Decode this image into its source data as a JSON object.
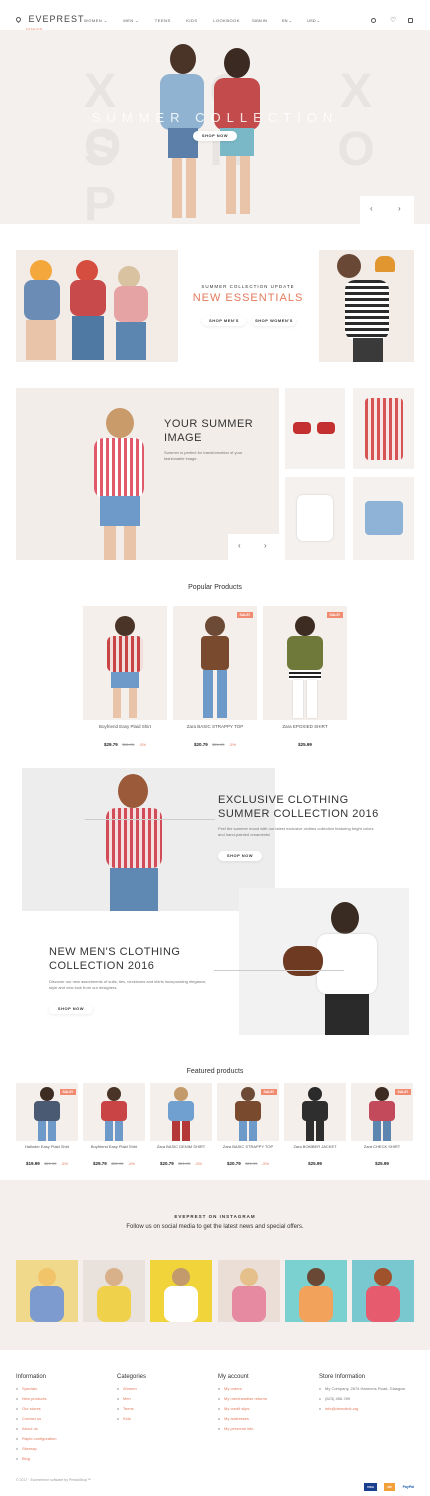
{
  "header": {
    "logo_text": "EVEPREST",
    "logo_sub": "FASHION",
    "nav": [
      {
        "label": "WOMEN ⌄"
      },
      {
        "label": "MEN ⌄"
      },
      {
        "label": "TEENS"
      },
      {
        "label": "KIDS"
      },
      {
        "label": "LOOKBOOK"
      }
    ],
    "sign_in": "SIGN IN",
    "lang": "EN ⌄",
    "currency": "USD ⌄"
  },
  "hero": {
    "bg_letters_1": "X O X O",
    "bg_letters_2": "S H O P",
    "subtitle": "SUMMER COLLECTION",
    "button": "SHOP NOW",
    "prev": "‹",
    "next": "›"
  },
  "promo": {
    "eyebrow": "SUMMER COLLECTION UPDATE",
    "title": "NEW ESSENTIALS",
    "btn_men": "SHOP MEN'S",
    "btn_women": "SHOP WOMEN'S"
  },
  "summer": {
    "title_line1": "YOUR SUMMER",
    "title_line2": "IMAGE",
    "desc": "Summer is perfect for transformation of your fashionable image.",
    "prev": "‹",
    "next": "›"
  },
  "popular": {
    "heading": "Popular Products",
    "items": [
      {
        "name": "Boyfriend Easy Plaid Shirt",
        "price": "$29.79",
        "old": "$31.95",
        "disc": "-5%",
        "sale": ""
      },
      {
        "name": "Zara BASIC STRAPPY TOP",
        "price": "$20.79",
        "old": "$21.95",
        "disc": "-5%",
        "sale": "SALE!"
      },
      {
        "name": "Zara EPOXIED SHIRT",
        "price": "$25.99",
        "old": "",
        "disc": "",
        "sale": "SALE!"
      }
    ]
  },
  "exclusive": {
    "title_line1": "EXCLUSIVE CLOTHING",
    "title_line2": "SUMMER COLLECTION 2016",
    "desc": "Feel the summer mood with our latest exclusive clothes collection featuring bright colors and hand-painted ornaments!",
    "button": "SHOP NOW"
  },
  "mens": {
    "title_line1": "NEW MEN'S CLOTHING",
    "title_line2": "COLLECTION 2016",
    "desc": "Discover our new assortments of suits, ties, neckloons and shirts incorporating elegance, style and new look from our designers.",
    "button": "SHOP NOW"
  },
  "featured": {
    "heading": "Featured products",
    "items": [
      {
        "name": "Halloder Easy Plaid Shirt",
        "price": "$19.99",
        "old": "$21.95",
        "disc": "-5%",
        "sale": "SALE!"
      },
      {
        "name": "Boyfriend Easy Plaid Shirt",
        "price": "$29.79",
        "old": "$31.95",
        "disc": "-5%",
        "sale": ""
      },
      {
        "name": "Zara BASIC DENIM SHIRT",
        "price": "$20.79",
        "old": "$21.95",
        "disc": "-5%",
        "sale": ""
      },
      {
        "name": "Zara BASIC STRAPPY TOP",
        "price": "$20.79",
        "old": "$21.95",
        "disc": "-5%",
        "sale": "SALE!"
      },
      {
        "name": "Zara BOMBER JACKET",
        "price": "$25.99",
        "old": "",
        "disc": "",
        "sale": ""
      },
      {
        "name": "Zara CHECK SHIRT",
        "price": "$25.99",
        "old": "",
        "disc": "",
        "sale": "SALE!"
      }
    ]
  },
  "instagram": {
    "eyebrow": "EVEPREST ON INSTAGRAM",
    "title": "Follow us on social media to get the latest news and special offers."
  },
  "footer": {
    "col1": {
      "heading": "Information",
      "links": [
        "Specials",
        "New products",
        "Our stores",
        "Contact us",
        "About us",
        "Rapid configuration",
        "Sitemap",
        "Blog"
      ]
    },
    "col2": {
      "heading": "Categories",
      "links": [
        "Women",
        "Men",
        "Teens",
        "Kids"
      ]
    },
    "col3": {
      "heading": "My account",
      "links": [
        "My orders",
        "My merchandise returns",
        "My credit slips",
        "My addresses",
        "My personal info"
      ]
    },
    "col4": {
      "heading": "Store Information",
      "address": "My Company, 2674 Harmons Road, Glasgow",
      "phone": "(623) 456-789",
      "email": "info@demolink.org"
    },
    "copyright": "© 2017 · Ecommerce software by PrestaShop™",
    "payments": [
      "VISA",
      "MC",
      "PayPal"
    ]
  },
  "colors": {
    "accent": "#e27a5c",
    "bg_light": "#f3eeeb"
  }
}
